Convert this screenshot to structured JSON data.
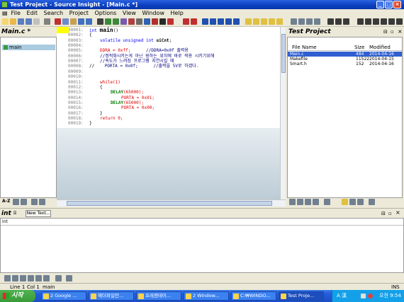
{
  "window": {
    "title": "Test Project - Source Insight - [Main.c *]"
  },
  "menu": [
    "File",
    "Edit",
    "Search",
    "Project",
    "Options",
    "View",
    "Window",
    "Help"
  ],
  "left_panel": {
    "title": "Main.c *",
    "items": [
      {
        "label": "main"
      }
    ]
  },
  "editor": {
    "lines": [
      {
        "num": "00001:",
        "kind": "sig",
        "keyword": "int",
        "name": "main",
        "rest": "()"
      },
      {
        "num": "00002:",
        "kind": "plain",
        "text": "{"
      },
      {
        "num": "00003:",
        "kind": "decl",
        "keyword": "volatile unsigned int",
        "name": "uiCnt",
        "rest": ";"
      },
      {
        "num": "00004:",
        "kind": "plain",
        "text": ""
      },
      {
        "num": "00005:",
        "kind": "assign_comment",
        "code": "DDRA = 0xff;",
        "comment": "//DDRA=0x0f 출력용"
      },
      {
        "num": "00006:",
        "kind": "comment",
        "text": "//정적화시키는게 아닌 원하는 위치에 바로 적용 시키기위해"
      },
      {
        "num": "00007:",
        "kind": "comment",
        "text": "//속도가 느려짐 프로그램 지연시킬 때"
      },
      {
        "num": "00008:",
        "kind": "assign_comment_prefix",
        "prefix": "//",
        "code": "PORTA = 0x0f;",
        "comment": "//출력을 5V로 하겠다."
      },
      {
        "num": "00009:",
        "kind": "plain",
        "text": ""
      },
      {
        "num": "00010:",
        "kind": "plain",
        "text": ""
      },
      {
        "num": "00011:",
        "kind": "keyword",
        "text": "while(1)"
      },
      {
        "num": "00012:",
        "kind": "plain",
        "text": "{"
      },
      {
        "num": "00013:",
        "kind": "call",
        "name": "DELAY",
        "arg": "(65000);"
      },
      {
        "num": "00014:",
        "kind": "assign",
        "text": "PORTA = 0x01;"
      },
      {
        "num": "00015:",
        "kind": "call",
        "name": "DELAY",
        "arg": "(65000);"
      },
      {
        "num": "00016:",
        "kind": "assign",
        "text": "PORTA = 0x00;"
      },
      {
        "num": "00017:",
        "kind": "plain",
        "text": "}"
      },
      {
        "num": "00018:",
        "kind": "keyword",
        "text": "return 0;"
      },
      {
        "num": "00019:",
        "kind": "plain",
        "text": "}"
      }
    ]
  },
  "right_panel": {
    "title": "Test Project",
    "columns": {
      "name": "File Name",
      "size": "Size",
      "modified": "Modified"
    },
    "files": [
      {
        "name": "Main.c",
        "size": "484",
        "modified": "2014-04-16",
        "selected": true
      },
      {
        "name": "Makefile",
        "size": "11522",
        "modified": "2014-04-15",
        "selected": false
      },
      {
        "name": "Smart.h",
        "size": "152",
        "modified": "2014-04-16",
        "selected": false
      }
    ]
  },
  "bottom_panel": {
    "title": "int",
    "button": "New Text...",
    "content": "int"
  },
  "status": {
    "line": "Line 1",
    "col": "Col 1",
    "func": "main",
    "mode": "INS"
  },
  "taskbar": {
    "start": "시작",
    "tasks": [
      {
        "label": "2 Google ..."
      },
      {
        "label": "헤더파일만..."
      },
      {
        "label": "프레젠테이..."
      },
      {
        "label": "2 Window..."
      },
      {
        "label": "C:₩WINDO..."
      },
      {
        "label": "Test Proje..."
      }
    ],
    "ime": "A 漢",
    "clock": "오전 9:54"
  },
  "colors": {
    "title_bar": "#0a3fc0",
    "keyword": "#0000ff",
    "value": "#e00000",
    "comment": "#000080",
    "selection": "#2f5fd0"
  }
}
